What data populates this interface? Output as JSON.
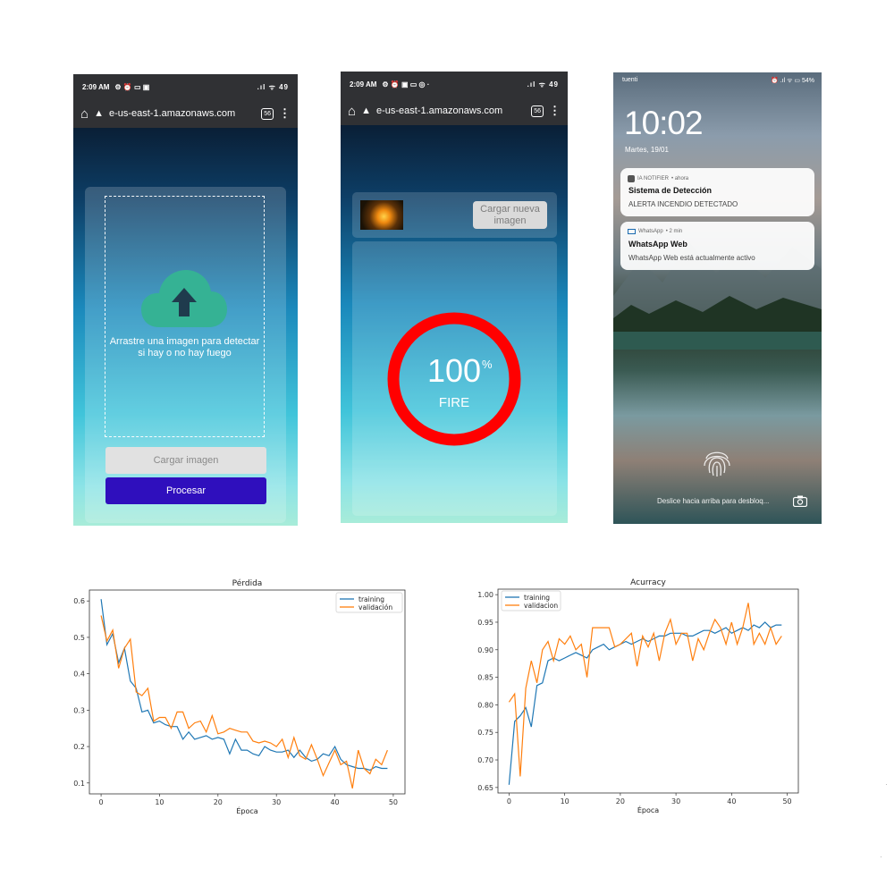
{
  "phone1": {
    "status_time": "2:09 AM",
    "status_icons": "⚙ ⏰ ▭ ▣",
    "status_right": ".ıl ᯤ 49",
    "url": "e-us-east-1.amazonaws.com",
    "tab_count": "56",
    "drop_text": "Arrastre una imagen para detectar si hay o no hay fuego",
    "load_button": "Cargar imagen",
    "process_button": "Procesar",
    "colors": {
      "cloud": "#35b294",
      "process_button": "#2f0fbd"
    }
  },
  "phone2": {
    "status_time": "2:09 AM",
    "status_icons": "⚙ ⏰ ▣ ▭ ◎ ·",
    "status_right": ".ıl ᯤ 49",
    "url": "e-us-east-1.amazonaws.com",
    "tab_count": "56",
    "new_image_button": "Cargar nueva imagen",
    "result_percent": "100",
    "percent_sign": "%",
    "result_class": "FIRE",
    "colors": {
      "ring": "#ff0000"
    }
  },
  "phone3": {
    "carrier": "tuenti",
    "status_right": "⏰ .ıl ᯤ ▭ 54%",
    "time": "10:02",
    "date": "Martes, 19/01",
    "notifications": [
      {
        "app": "IA NOTIFIER",
        "when": "• ahora",
        "title": "Sistema de Detección",
        "body": "ALERTA INCENDIO DETECTADO"
      },
      {
        "app": "WhatsApp",
        "when": "• 2 min",
        "title": "WhatsApp Web",
        "body": "WhatsApp Web está actualmente activo"
      }
    ],
    "swipe_hint": "Deslice hacia arriba para desbloq..."
  },
  "chart_data": [
    {
      "type": "line",
      "title": "Pérdida",
      "xlabel": "Época",
      "ylabel": "",
      "xlim": [
        -2,
        52
      ],
      "ylim": [
        0.07,
        0.63
      ],
      "xticks": [
        0,
        10,
        20,
        30,
        40,
        50
      ],
      "yticks": [
        0.1,
        0.2,
        0.3,
        0.4,
        0.5,
        0.6
      ],
      "legend_position": "top-right",
      "series": [
        {
          "name": "training",
          "color": "#1f77b4",
          "x": [
            0,
            1,
            2,
            3,
            4,
            5,
            6,
            7,
            8,
            9,
            10,
            11,
            12,
            13,
            14,
            15,
            16,
            17,
            18,
            19,
            20,
            21,
            22,
            23,
            24,
            25,
            26,
            27,
            28,
            29,
            30,
            31,
            32,
            33,
            34,
            35,
            36,
            37,
            38,
            39,
            40,
            41,
            42,
            43,
            44,
            45,
            46,
            47,
            48,
            49
          ],
          "values": [
            0.605,
            0.48,
            0.51,
            0.43,
            0.47,
            0.38,
            0.36,
            0.295,
            0.3,
            0.265,
            0.27,
            0.26,
            0.255,
            0.255,
            0.22,
            0.24,
            0.22,
            0.225,
            0.23,
            0.22,
            0.225,
            0.22,
            0.18,
            0.22,
            0.19,
            0.19,
            0.18,
            0.175,
            0.2,
            0.19,
            0.185,
            0.185,
            0.19,
            0.17,
            0.19,
            0.17,
            0.16,
            0.165,
            0.18,
            0.175,
            0.2,
            0.165,
            0.15,
            0.145,
            0.14,
            0.14,
            0.135,
            0.145,
            0.14,
            0.14
          ]
        },
        {
          "name": "validación",
          "color": "#ff7f0e",
          "x": [
            0,
            1,
            2,
            3,
            4,
            5,
            6,
            7,
            8,
            9,
            10,
            11,
            12,
            13,
            14,
            15,
            16,
            17,
            18,
            19,
            20,
            21,
            22,
            23,
            24,
            25,
            26,
            27,
            28,
            29,
            30,
            31,
            32,
            33,
            34,
            35,
            36,
            37,
            38,
            39,
            40,
            41,
            42,
            43,
            44,
            45,
            46,
            47,
            48,
            49
          ],
          "values": [
            0.56,
            0.49,
            0.52,
            0.415,
            0.47,
            0.495,
            0.35,
            0.34,
            0.36,
            0.27,
            0.28,
            0.28,
            0.25,
            0.295,
            0.295,
            0.25,
            0.265,
            0.27,
            0.24,
            0.285,
            0.235,
            0.24,
            0.25,
            0.245,
            0.24,
            0.24,
            0.215,
            0.21,
            0.215,
            0.21,
            0.2,
            0.22,
            0.17,
            0.225,
            0.175,
            0.165,
            0.205,
            0.165,
            0.12,
            0.155,
            0.19,
            0.15,
            0.16,
            0.085,
            0.19,
            0.14,
            0.125,
            0.165,
            0.15,
            0.19
          ]
        }
      ]
    },
    {
      "type": "line",
      "title": "Acurracy",
      "xlabel": "Época",
      "ylabel": "",
      "xlim": [
        -2,
        52
      ],
      "ylim": [
        0.64,
        1.01
      ],
      "xticks": [
        0,
        10,
        20,
        30,
        40,
        50
      ],
      "yticks": [
        0.65,
        0.7,
        0.75,
        0.8,
        0.85,
        0.9,
        0.95,
        1.0
      ],
      "legend_position": "top-left",
      "series": [
        {
          "name": "training",
          "color": "#1f77b4",
          "x": [
            0,
            1,
            2,
            3,
            4,
            5,
            6,
            7,
            8,
            9,
            10,
            11,
            12,
            13,
            14,
            15,
            16,
            17,
            18,
            19,
            20,
            21,
            22,
            23,
            24,
            25,
            26,
            27,
            28,
            29,
            30,
            31,
            32,
            33,
            34,
            35,
            36,
            37,
            38,
            39,
            40,
            41,
            42,
            43,
            44,
            45,
            46,
            47,
            48,
            49
          ],
          "values": [
            0.655,
            0.77,
            0.78,
            0.795,
            0.76,
            0.835,
            0.84,
            0.88,
            0.885,
            0.88,
            0.885,
            0.89,
            0.895,
            0.89,
            0.885,
            0.9,
            0.905,
            0.91,
            0.9,
            0.905,
            0.91,
            0.915,
            0.91,
            0.915,
            0.92,
            0.915,
            0.92,
            0.925,
            0.925,
            0.93,
            0.93,
            0.93,
            0.925,
            0.925,
            0.93,
            0.935,
            0.935,
            0.93,
            0.935,
            0.94,
            0.93,
            0.935,
            0.94,
            0.935,
            0.945,
            0.94,
            0.95,
            0.94,
            0.945,
            0.945
          ]
        },
        {
          "name": "validacion",
          "color": "#ff7f0e",
          "x": [
            0,
            1,
            2,
            3,
            4,
            5,
            6,
            7,
            8,
            9,
            10,
            11,
            12,
            13,
            14,
            15,
            16,
            17,
            18,
            19,
            20,
            21,
            22,
            23,
            24,
            25,
            26,
            27,
            28,
            29,
            30,
            31,
            32,
            33,
            34,
            35,
            36,
            37,
            38,
            39,
            40,
            41,
            42,
            43,
            44,
            45,
            46,
            47,
            48,
            49
          ],
          "values": [
            0.805,
            0.82,
            0.67,
            0.83,
            0.88,
            0.84,
            0.9,
            0.915,
            0.88,
            0.92,
            0.91,
            0.925,
            0.9,
            0.91,
            0.85,
            0.94,
            0.94,
            0.94,
            0.94,
            0.905,
            0.91,
            0.92,
            0.93,
            0.87,
            0.925,
            0.905,
            0.93,
            0.88,
            0.93,
            0.955,
            0.91,
            0.93,
            0.93,
            0.88,
            0.92,
            0.9,
            0.93,
            0.955,
            0.94,
            0.91,
            0.95,
            0.91,
            0.94,
            0.985,
            0.91,
            0.93,
            0.91,
            0.94,
            0.91,
            0.925
          ]
        }
      ]
    }
  ]
}
